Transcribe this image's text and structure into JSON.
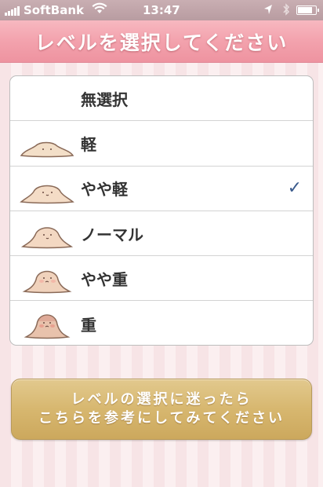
{
  "status": {
    "carrier": "SoftBank",
    "time": "13:47",
    "signal_bars": 5,
    "battery_level": 0.85,
    "icons": [
      "wifi-icon",
      "location-icon",
      "bluetooth-icon",
      "battery-icon"
    ]
  },
  "header": {
    "title": "レベルを選択してください"
  },
  "levels": [
    {
      "label": "無選択",
      "icon": null,
      "selected": false
    },
    {
      "label": "軽",
      "icon": "blob-light-icon",
      "selected": false
    },
    {
      "label": "やや軽",
      "icon": "blob-slightly-light-icon",
      "selected": true
    },
    {
      "label": "ノーマル",
      "icon": "blob-normal-icon",
      "selected": false
    },
    {
      "label": "やや重",
      "icon": "blob-slightly-heavy-icon",
      "selected": false
    },
    {
      "label": "重",
      "icon": "blob-heavy-icon",
      "selected": false
    }
  ],
  "checkmark": "✓",
  "help_button": {
    "line1": "レベルの選択に迷ったら",
    "line2": "こちらを参考にしてみてください"
  },
  "colors": {
    "title_bar": "#f3a2ad",
    "check": "#3a5a8c",
    "button": "#d7b76f"
  }
}
